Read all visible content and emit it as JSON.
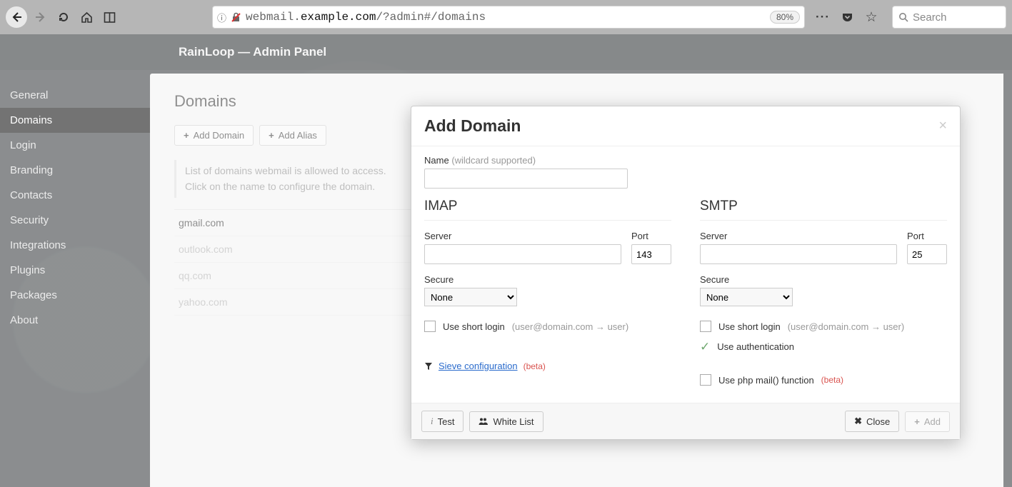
{
  "browser": {
    "url_pre": "webmail.",
    "url_host": "example.com",
    "url_post": "/?admin#/domains",
    "zoom": "80%",
    "search_placeholder": "Search"
  },
  "header": {
    "title": "RainLoop — Admin Panel"
  },
  "sidebar": {
    "general": "General",
    "domains": "Domains",
    "login": "Login",
    "branding": "Branding",
    "contacts": "Contacts",
    "security": "Security",
    "integrations": "Integrations",
    "plugins": "Plugins",
    "packages": "Packages",
    "about": "About"
  },
  "page": {
    "title": "Domains",
    "add_domain": "Add Domain",
    "add_alias": "Add Alias",
    "hint_line1": "List of domains webmail is allowed to access.",
    "hint_line2": "Click on the name to configure the domain.",
    "domains": [
      "gmail.com",
      "outlook.com",
      "qq.com",
      "yahoo.com"
    ]
  },
  "modal": {
    "title": "Add Domain",
    "name_label": "Name",
    "name_hint": "(wildcard supported)",
    "imap": {
      "heading": "IMAP",
      "server_label": "Server",
      "port_label": "Port",
      "port_value": "143",
      "secure_label": "Secure",
      "secure_value": "None",
      "short_login_label": "Use short login",
      "short_login_hint": "(user@domain.com → user)"
    },
    "smtp": {
      "heading": "SMTP",
      "server_label": "Server",
      "port_label": "Port",
      "port_value": "25",
      "secure_label": "Secure",
      "secure_value": "None",
      "short_login_label": "Use short login",
      "short_login_hint": "(user@domain.com → user)",
      "use_auth_label": "Use authentication",
      "phpmail_label": "Use php mail() function",
      "phpmail_beta": "(beta)"
    },
    "sieve_label": "Sieve configuration",
    "sieve_beta": "(beta)",
    "footer": {
      "test": "Test",
      "whitelist": "White List",
      "close": "Close",
      "add": "Add"
    }
  }
}
